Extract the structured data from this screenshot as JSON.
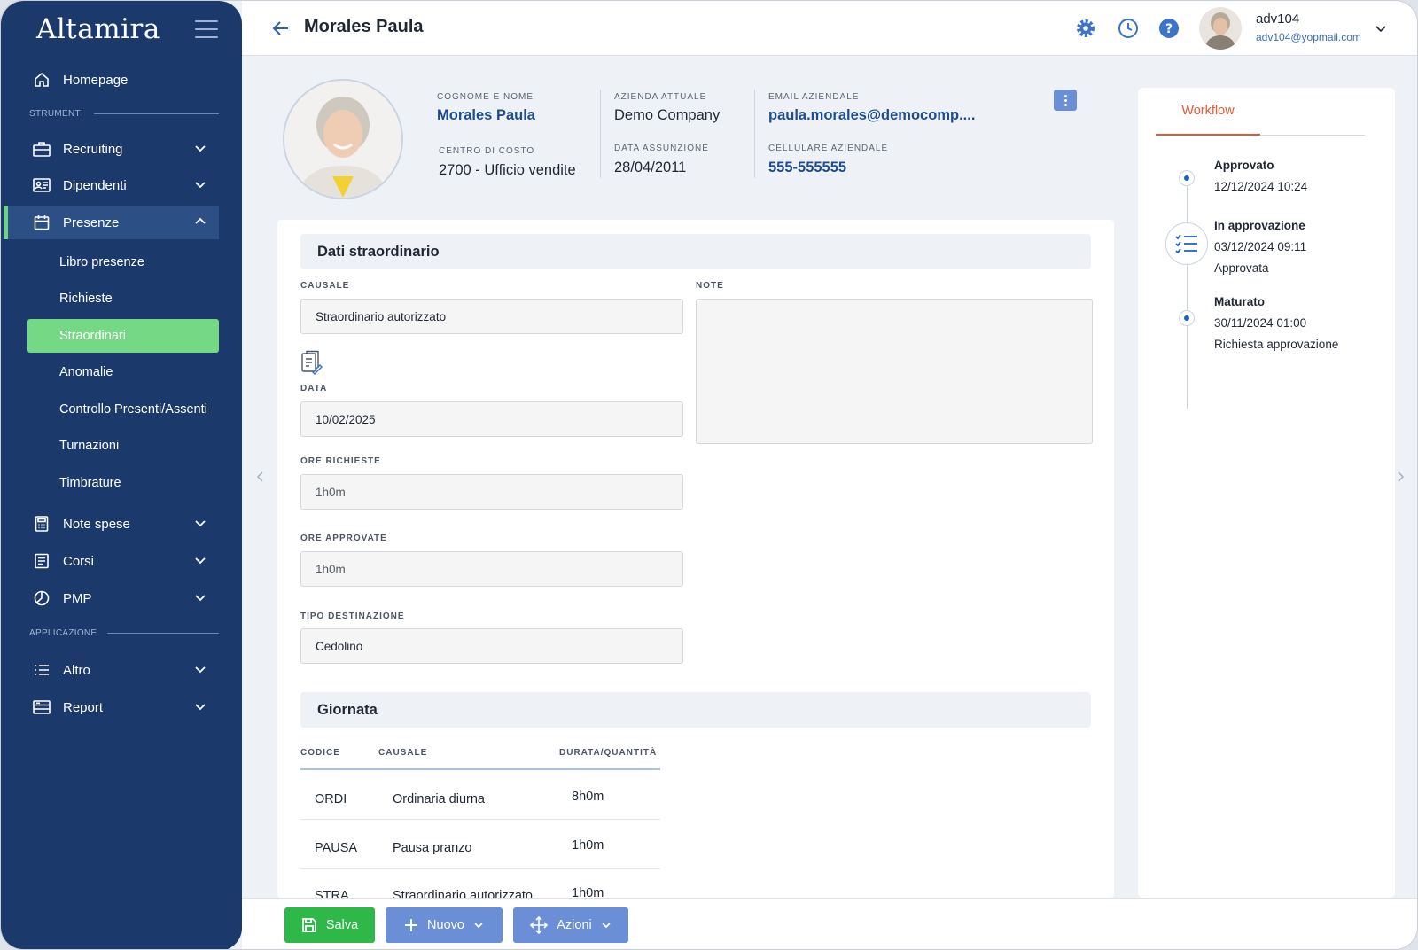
{
  "app": {
    "logo": "Altamira"
  },
  "sidebar": {
    "section_tools": "STRUMENTI",
    "section_app": "APPLICAZIONE",
    "items": {
      "homepage": "Homepage",
      "recruiting": "Recruiting",
      "dipendenti": "Dipendenti",
      "presenze": "Presenze",
      "note_spese": "Note spese",
      "corsi": "Corsi",
      "pmp": "PMP",
      "altro": "Altro",
      "report": "Report"
    },
    "presenze_sub": {
      "libro": "Libro presenze",
      "richieste": "Richieste",
      "straordinari": "Straordinari",
      "anomalie": "Anomalie",
      "controllo": "Controllo Presenti/Assenti",
      "turnazioni": "Turnazioni",
      "timbrature": "Timbrature"
    },
    "accent_color": "#74d884"
  },
  "header": {
    "title": "Morales Paula",
    "user_name": "adv104",
    "user_email": "adv104@yopmail.com"
  },
  "employee": {
    "label_name": "COGNOME E NOME",
    "name": "Morales Paula",
    "label_cost_center": "CENTRO DI COSTO",
    "cost_center": "2700 - Ufficio vendite",
    "label_company": "AZIENDA ATTUALE",
    "company": "Demo Company",
    "label_hire_date": "DATA ASSUNZIONE",
    "hire_date": "28/04/2011",
    "label_email": "EMAIL AZIENDALE",
    "email": "paula.morales@democomp....",
    "label_phone": "CELLULARE AZIENDALE",
    "phone": "555-555555"
  },
  "form": {
    "section_title": "Dati straordinario",
    "causale_label": "CAUSALE",
    "causale_value": "Straordinario autorizzato",
    "note_label": "NOTE",
    "data_label": "DATA",
    "data_value": "10/02/2025",
    "ore_richieste_label": "ORE RICHIESTE",
    "ore_richieste_value": "1h0m",
    "ore_approvate_label": "ORE APPROVATE",
    "ore_approvate_value": "1h0m",
    "tipo_dest_label": "TIPO DESTINAZIONE",
    "tipo_dest_value": "Cedolino"
  },
  "giornata": {
    "section_title": "Giornata",
    "columns": [
      "CODICE",
      "CAUSALE",
      "DURATA/QUANTITÀ"
    ],
    "rows": [
      {
        "codice": "ORDI",
        "causale": "Ordinaria diurna",
        "durata": "8h0m"
      },
      {
        "codice": "PAUSA",
        "causale": "Pausa pranzo",
        "durata": "1h0m"
      },
      {
        "codice": "STRA",
        "causale": "Straordinario autorizzato",
        "durata": "1h0m"
      }
    ]
  },
  "workflow": {
    "tab": "Workflow",
    "steps": [
      {
        "title": "Approvato",
        "date": "12/12/2024 10:24",
        "note": ""
      },
      {
        "title": "In approvazione",
        "date": "03/12/2024 09:11",
        "note": "Approvata"
      },
      {
        "title": "Maturato",
        "date": "30/11/2024 01:00",
        "note": "Richiesta approvazione"
      }
    ]
  },
  "actions": {
    "save": "Salva",
    "new": "Nuovo",
    "actions": "Azioni"
  },
  "colors": {
    "sidebar_bg": "#1b3a6b",
    "save_green": "#2eb848",
    "button_blue": "#6b8fd6",
    "workflow_accent": "#e05a34"
  }
}
